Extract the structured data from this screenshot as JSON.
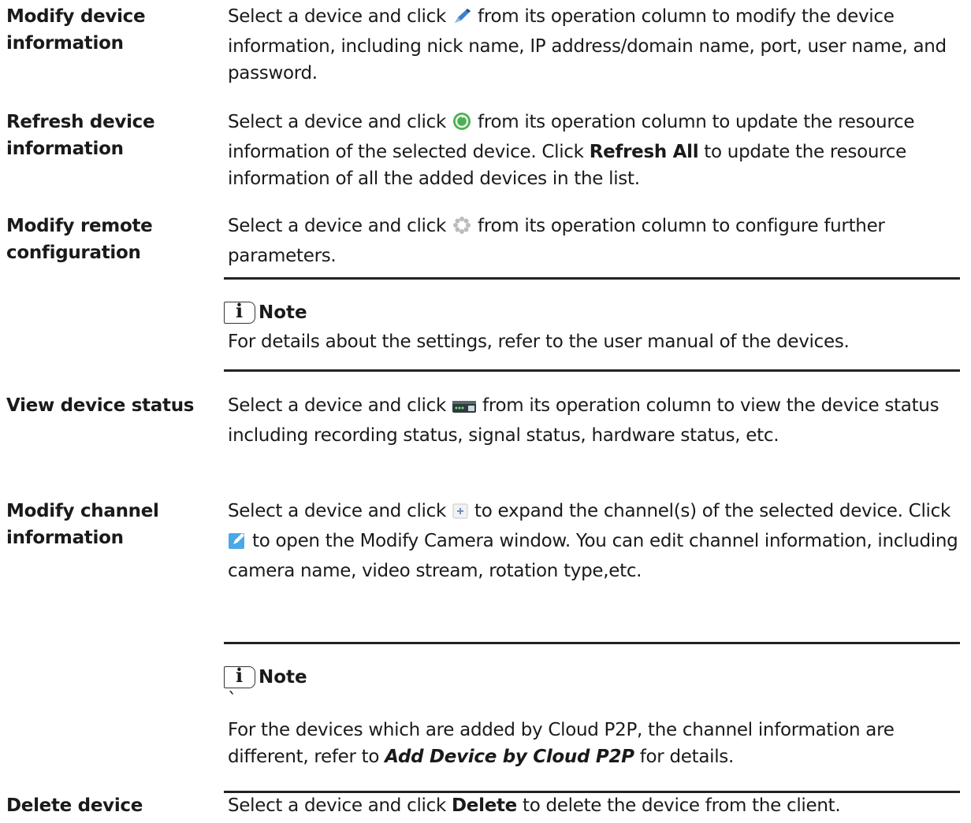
{
  "rows": [
    {
      "term": "Modify device information",
      "desc_before": "Select a device and click ",
      "icon": "pencil-icon",
      "desc_after": " from its operation column to modify the device information, including nick name, IP address/domain name, port, user name, and password."
    },
    {
      "term": "Refresh device information",
      "desc_before": "Select a device and click ",
      "icon": "refresh-icon",
      "desc_mid": " from its operation column to update the resource information of the selected device. Click ",
      "bold1": "Refresh All",
      "desc_after": " to update the resource information of all the added devices in the list."
    },
    {
      "term": "Modify remote configuration",
      "desc_before": "Select a device and click ",
      "icon": "gear-icon",
      "desc_after": " from its operation column to configure further parameters."
    },
    {
      "term": "View device status",
      "desc_before": "Select a device and click ",
      "icon": "device-status-icon",
      "desc_after": " from its operation column to view the device status including recording status, signal status, hardware status, etc."
    },
    {
      "term": "Modify channel information",
      "desc_before": "Select a device and click ",
      "icon": "expand-plus-icon",
      "desc_mid": " to expand the channel(s) of the selected device. Click ",
      "icon2": "edit-icon",
      "desc_after": " to open the Modify Camera window. You can edit channel information, including camera name, video stream, rotation type,etc."
    },
    {
      "term": "Delete device",
      "desc_before": "Select a device and click ",
      "bold1": "Delete",
      "desc_after": " to delete the device from the client."
    }
  ],
  "notes": [
    {
      "title": "Note",
      "text": "For details about the settings, refer to the user manual of the devices."
    },
    {
      "title": "Note",
      "stray": "`",
      "text_before": "For the devices which are added by Cloud P2P, the channel information are different, refer to ",
      "link": "Add Device by Cloud P2P",
      "text_after": " for details."
    }
  ]
}
